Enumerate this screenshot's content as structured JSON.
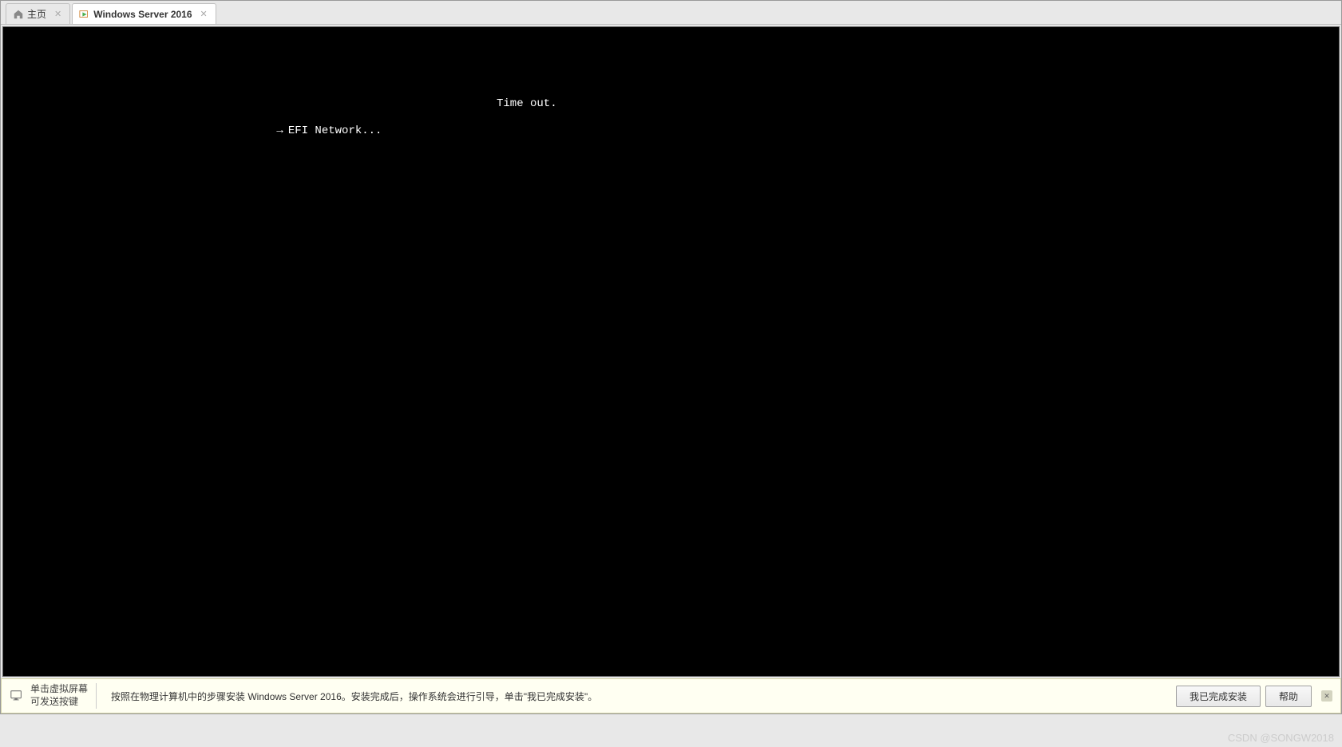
{
  "tabs": [
    {
      "label": "主页",
      "active": false
    },
    {
      "label": "Windows Server 2016",
      "active": true
    }
  ],
  "console": {
    "line1": "Time out.",
    "arrow": "→",
    "line2": "EFI Network..."
  },
  "status": {
    "hint_line1": "单击虚拟屏幕",
    "hint_line2": "可发送按键",
    "instruction": "按照在物理计算机中的步骤安装 Windows Server 2016。安装完成后，操作系统会进行引导，单击\"我已完成安装\"。",
    "btn_done": "我已完成安装",
    "btn_help": "帮助"
  },
  "watermark": "CSDN @SONGW2018"
}
